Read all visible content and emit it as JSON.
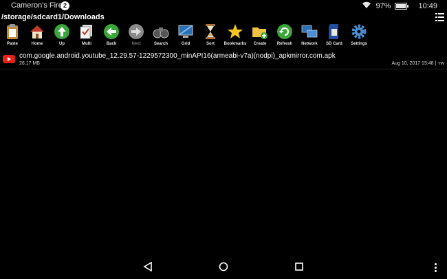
{
  "status": {
    "device_name": "Cameron's Fire",
    "notification_count": "2",
    "battery_percent": "97%",
    "battery_level": 0.97,
    "time": "10:49",
    "icons": [
      "wifi-icon",
      "battery-icon"
    ]
  },
  "path": "/storage/sdcard1/Downloads",
  "toolbar": [
    {
      "label": "Paste",
      "icon": "paste-icon",
      "enabled": true
    },
    {
      "label": "Home",
      "icon": "home-icon",
      "enabled": true
    },
    {
      "label": "Up",
      "icon": "up-arrow-icon",
      "enabled": true
    },
    {
      "label": "Multi",
      "icon": "multi-select-icon",
      "enabled": true
    },
    {
      "label": "Back",
      "icon": "back-arrow-icon",
      "enabled": true
    },
    {
      "label": "Next",
      "icon": "next-arrow-icon",
      "enabled": false
    },
    {
      "label": "Search",
      "icon": "binoculars-icon",
      "enabled": true
    },
    {
      "label": "Grid",
      "icon": "grid-monitor-icon",
      "enabled": true
    },
    {
      "label": "Sort",
      "icon": "hourglass-icon",
      "enabled": true
    },
    {
      "label": "Bookmarks",
      "icon": "star-icon",
      "enabled": true
    },
    {
      "label": "Create",
      "icon": "folder-add-icon",
      "enabled": true
    },
    {
      "label": "Refresh",
      "icon": "refresh-icon",
      "enabled": true
    },
    {
      "label": "Network",
      "icon": "network-icon",
      "enabled": true
    },
    {
      "label": "SD Card",
      "icon": "sd-card-icon",
      "enabled": true
    },
    {
      "label": "Settings",
      "icon": "gear-icon",
      "enabled": true
    }
  ],
  "files": [
    {
      "name": "com.google.android.youtube_12.29.57-1229572300_minAPI16(armeabi-v7a)(nodpi)_apkmirror.com.apk",
      "size": "26.17 MB",
      "meta": "Aug 10, 2017 15:48 | -rw",
      "icon": "youtube-icon"
    }
  ],
  "navbar": {
    "icons": [
      "back-triangle-icon",
      "home-circle-icon",
      "recents-square-icon",
      "overflow-menu-icon"
    ]
  },
  "colors": {
    "youtube_red": "#e62117",
    "background": "#000000"
  }
}
